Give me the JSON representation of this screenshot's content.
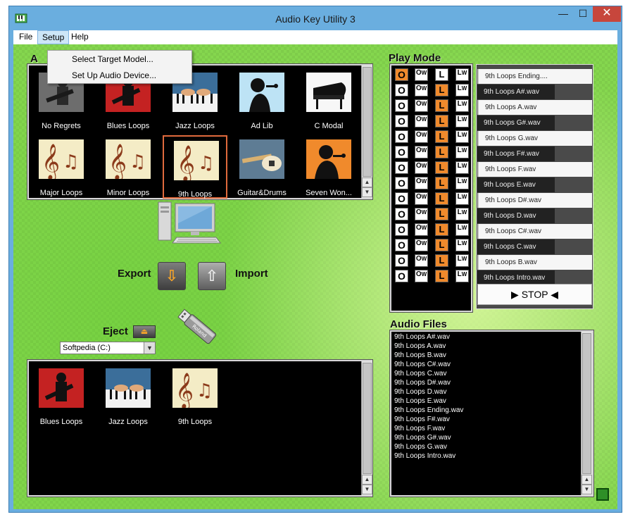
{
  "window": {
    "title": "Audio Key Utility 3",
    "min_glyph": "—",
    "max_glyph": "☐",
    "close_glyph": "✕"
  },
  "menu": {
    "file": "File",
    "setup": "Setup",
    "help": "Help",
    "setup_items": [
      "Select Target Model...",
      "Set Up Audio Device..."
    ]
  },
  "library": {
    "label": "A",
    "tiles": [
      {
        "label": "No Regrets",
        "icon": "guitarist-photo-icon"
      },
      {
        "label": "Blues Loops",
        "icon": "guitarist-red-photo-icon"
      },
      {
        "label": "Jazz Loops",
        "icon": "piano-keys-photo-icon"
      },
      {
        "label": "Ad Lib",
        "icon": "singer-silhouette-icon"
      },
      {
        "label": "C Modal",
        "icon": "grand-piano-icon"
      },
      {
        "label": "Major Loops",
        "icon": "treble-clef-icon"
      },
      {
        "label": "Minor Loops",
        "icon": "treble-clef-icon"
      },
      {
        "label": "9th Loops",
        "icon": "treble-clef-icon"
      },
      {
        "label": "Guitar&Drums",
        "icon": "electric-guitar-icon"
      },
      {
        "label": "Seven Won...",
        "icon": "singer-orange-icon"
      }
    ]
  },
  "transfer": {
    "export_label": "Export",
    "import_label": "Import",
    "export_glyph": "⇩",
    "import_glyph": "⇧",
    "eject_label": "Eject",
    "eject_glyph": "⏏",
    "drive": "Softpedia (C:)",
    "usb_brand": "Roland"
  },
  "usb_content": {
    "tiles": [
      {
        "label": "Blues Loops",
        "icon": "guitarist-red-photo-icon"
      },
      {
        "label": "Jazz Loops",
        "icon": "piano-keys-photo-icon"
      },
      {
        "label": "9th Loops",
        "icon": "treble-clef-icon"
      }
    ]
  },
  "play_mode": {
    "label": "Play Mode",
    "glyph_o": "O",
    "glyph_l": "L",
    "sub_w": "W",
    "rows": [
      {
        "o_active": true,
        "l_active": false
      },
      {
        "o_active": false,
        "l_active": true
      },
      {
        "o_active": false,
        "l_active": true
      },
      {
        "o_active": false,
        "l_active": true
      },
      {
        "o_active": false,
        "l_active": true
      },
      {
        "o_active": false,
        "l_active": true
      },
      {
        "o_active": false,
        "l_active": true
      },
      {
        "o_active": false,
        "l_active": true
      },
      {
        "o_active": false,
        "l_active": true
      },
      {
        "o_active": false,
        "l_active": true
      },
      {
        "o_active": false,
        "l_active": true
      },
      {
        "o_active": false,
        "l_active": true
      },
      {
        "o_active": false,
        "l_active": true
      },
      {
        "o_active": false,
        "l_active": true
      }
    ],
    "slots": [
      "9th Loops Ending....",
      "9th Loops A#.wav",
      "9th Loops A.wav",
      "9th Loops G#.wav",
      "9th Loops G.wav",
      "9th Loops F#.wav",
      "9th Loops F.wav",
      "9th Loops E.wav",
      "9th Loops D#.wav",
      "9th Loops D.wav",
      "9th Loops C#.wav",
      "9th Loops C.wav",
      "9th Loops B.wav",
      "9th Loops Intro.wav"
    ],
    "stop_label": "▶ STOP ◀"
  },
  "audio_files": {
    "label": "Audio Files",
    "items": [
      "9th Loops A#.wav",
      "9th Loops A.wav",
      "9th Loops B.wav",
      "9th Loops C#.wav",
      "9th Loops C.wav",
      "9th Loops D#.wav",
      "9th Loops D.wav",
      "9th Loops E.wav",
      "9th Loops Ending.wav",
      "9th Loops F#.wav",
      "9th Loops F.wav",
      "9th Loops G#.wav",
      "9th Loops G.wav",
      "9th Loops Intro.wav"
    ]
  },
  "scroll_glyphs": {
    "up": "▲",
    "down": "▼"
  },
  "colors": {
    "accent_orange": "#f08a2c",
    "selection_border": "#e06a3d",
    "background_green": "#85d74e"
  }
}
